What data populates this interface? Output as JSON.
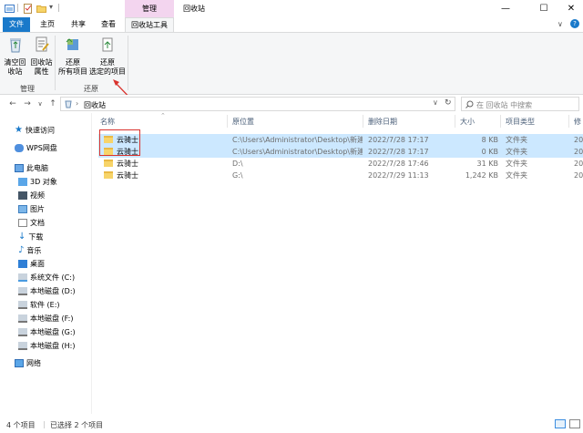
{
  "window": {
    "title": "回收站",
    "context_tab_group": "管理",
    "controls": {
      "minimize": "—",
      "maximize": "☐",
      "close": "✕"
    }
  },
  "ribbon_tabs": {
    "file": "文件",
    "home": "主页",
    "share": "共享",
    "view": "查看",
    "recycle_tools": "回收站工具"
  },
  "ribbon": {
    "empty_bin": [
      "清空回",
      "收站"
    ],
    "properties": [
      "回收站",
      "属性"
    ],
    "restore_all": [
      "还原",
      "所有项目"
    ],
    "restore_selected": [
      "还原",
      "选定的项目"
    ],
    "group_manage": "管理",
    "group_restore": "还原"
  },
  "address": {
    "path": "回收站",
    "search_placeholder": "在 回收站 中搜索"
  },
  "nav": {
    "quick_access": "快速访问",
    "wps": "WPS网盘",
    "this_pc": "此电脑",
    "items": [
      "3D 对象",
      "视频",
      "图片",
      "文档",
      "下载",
      "音乐",
      "桌面",
      "系统文件 (C:)",
      "本地磁盘 (D:)",
      "软件 (E:)",
      "本地磁盘 (F:)",
      "本地磁盘 (G:)",
      "本地磁盘 (H:)"
    ],
    "network": "网络"
  },
  "columns": {
    "name": "名称",
    "location": "原位置",
    "deleted": "删除日期",
    "size": "大小",
    "type": "项目类型",
    "modified": "修"
  },
  "files": [
    {
      "name": "云骑士",
      "location": "C:\\Users\\Administrator\\Desktop\\新建...",
      "deleted": "2022/7/28 17:17",
      "size": "8 KB",
      "type": "文件夹",
      "modified": "20",
      "selected": true
    },
    {
      "name": "云骑士",
      "location": "C:\\Users\\Administrator\\Desktop\\新建...",
      "deleted": "2022/7/28 17:17",
      "size": "0 KB",
      "type": "文件夹",
      "modified": "20",
      "selected": true
    },
    {
      "name": "云骑士",
      "location": "D:\\",
      "deleted": "2022/7/28 17:46",
      "size": "31 KB",
      "type": "文件夹",
      "modified": "20",
      "selected": false
    },
    {
      "name": "云骑士",
      "location": "G:\\",
      "deleted": "2022/7/29 11:13",
      "size": "1,242 KB",
      "type": "文件夹",
      "modified": "20",
      "selected": false
    }
  ],
  "status": {
    "count": "4 个项目",
    "selected": "已选择 2 个项目"
  },
  "colors": {
    "accent": "#1979ca",
    "selection": "#cce8ff",
    "context_tab": "#f3d5ef",
    "annotation": "#d9332e"
  },
  "icons": [
    "app-folder-icon",
    "checklist-icon",
    "new-folder-icon",
    "recycle-bin-icon",
    "properties-icon",
    "restore-all-icon",
    "restore-selected-icon",
    "back-icon",
    "forward-icon",
    "up-icon",
    "refresh-icon",
    "search-icon",
    "folder-icon",
    "details-view-icon",
    "tiles-view-icon"
  ]
}
